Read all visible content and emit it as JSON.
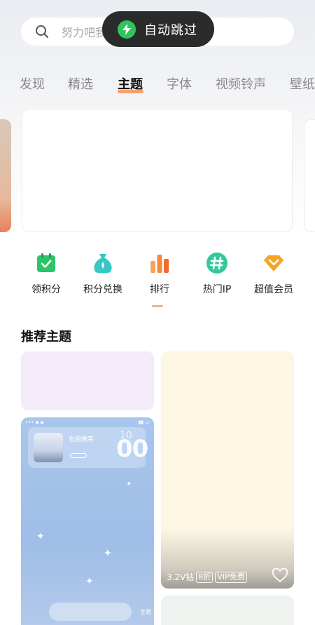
{
  "search": {
    "placeholder": "努力吧我的"
  },
  "toast": {
    "label": "自动跳过"
  },
  "tabs": [
    {
      "label": "发现"
    },
    {
      "label": "精选"
    },
    {
      "label": "主题"
    },
    {
      "label": "字体"
    },
    {
      "label": "视频铃声"
    },
    {
      "label": "壁纸"
    }
  ],
  "entries": [
    {
      "label": "领积分",
      "icon": "calendar-check-icon",
      "color": "#2cc36b"
    },
    {
      "label": "积分兑换",
      "icon": "money-bag-icon",
      "color": "#36c9c4"
    },
    {
      "label": "排行",
      "icon": "bar-chart-icon",
      "color": "#f58a3c"
    },
    {
      "label": "热门IP",
      "icon": "hashtag-icon",
      "color": "#36c79a"
    },
    {
      "label": "超值会员",
      "icon": "diamond-icon",
      "color": "#f7a323"
    }
  ],
  "section": {
    "title": "推荐主题"
  },
  "cards": {
    "price_card": {
      "price": "3.2V钻",
      "discount": "8折",
      "vip": "VIP免费"
    },
    "preview_card": {
      "name": "右肩微笑",
      "time_top": "10",
      "time": "00",
      "caption": "主题"
    }
  },
  "colors": {
    "accent": "#f6a071",
    "toast_bg": "#2b2b2b",
    "toast_icon": "#2fc45a"
  }
}
